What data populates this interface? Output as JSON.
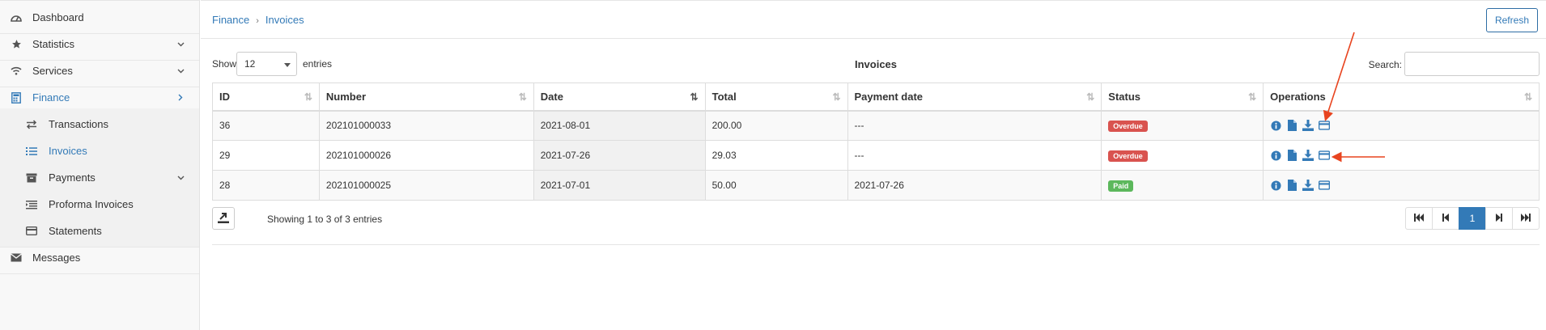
{
  "sidebar": {
    "items": [
      {
        "label": "Dashboard"
      },
      {
        "label": "Statistics"
      },
      {
        "label": "Services"
      },
      {
        "label": "Finance"
      },
      {
        "label": "Transactions"
      },
      {
        "label": "Invoices"
      },
      {
        "label": "Payments"
      },
      {
        "label": "Proforma Invoices"
      },
      {
        "label": "Statements"
      },
      {
        "label": "Messages"
      }
    ]
  },
  "breadcrumb": {
    "parent": "Finance",
    "current": "Invoices"
  },
  "header": {
    "refresh_label": "Refresh"
  },
  "controls": {
    "show_label": "Show",
    "entries_value": "12",
    "entries_label": "entries",
    "table_title": "Invoices",
    "search_label": "Search:"
  },
  "table": {
    "columns": [
      "ID",
      "Number",
      "Date",
      "Total",
      "Payment date",
      "Status",
      "Operations"
    ],
    "rows": [
      {
        "id": "36",
        "number": "202101000033",
        "date": "2021-08-01",
        "total": "200.00",
        "payment_date": "---",
        "status": "Overdue"
      },
      {
        "id": "29",
        "number": "202101000026",
        "date": "2021-07-26",
        "total": "29.03",
        "payment_date": "---",
        "status": "Overdue"
      },
      {
        "id": "28",
        "number": "202101000025",
        "date": "2021-07-01",
        "total": "50.00",
        "payment_date": "2021-07-26",
        "status": "Paid"
      }
    ]
  },
  "footer": {
    "info": "Showing 1 to 3 of 3 entries",
    "current_page": "1"
  },
  "colors": {
    "accent": "#337ab7",
    "overdue": "#d9534f",
    "paid": "#5cb85c",
    "annotation_arrow": "#e8441f"
  }
}
